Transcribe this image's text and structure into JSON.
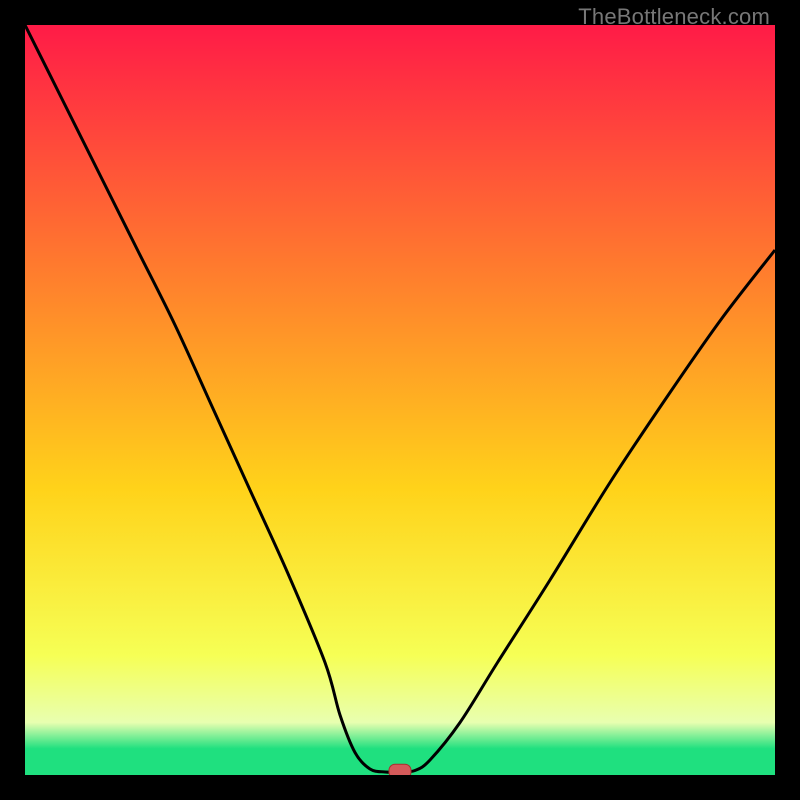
{
  "watermark": "TheBottleneck.com",
  "colors": {
    "top": "#ff1b47",
    "upper_mid": "#ff7a2e",
    "mid": "#ffd31a",
    "lower_mid": "#f6ff55",
    "pale": "#e8ffb0",
    "green": "#1fe07f",
    "curve": "#000000",
    "dot_fill": "#d45a5a",
    "dot_stroke": "#a82f2f",
    "frame": "#000000"
  },
  "chart_data": {
    "type": "line",
    "title": "",
    "xlabel": "",
    "ylabel": "",
    "xlim": [
      0,
      100
    ],
    "ylim": [
      0,
      100
    ],
    "curve": [
      {
        "x": 0,
        "y": 100
      },
      {
        "x": 5,
        "y": 90
      },
      {
        "x": 10,
        "y": 80
      },
      {
        "x": 15,
        "y": 70
      },
      {
        "x": 20,
        "y": 60
      },
      {
        "x": 25,
        "y": 49
      },
      {
        "x": 30,
        "y": 38
      },
      {
        "x": 35,
        "y": 27
      },
      {
        "x": 40,
        "y": 15
      },
      {
        "x": 42,
        "y": 8
      },
      {
        "x": 44,
        "y": 3
      },
      {
        "x": 46,
        "y": 0.8
      },
      {
        "x": 48,
        "y": 0.4
      },
      {
        "x": 50,
        "y": 0.4
      },
      {
        "x": 52,
        "y": 0.6
      },
      {
        "x": 54,
        "y": 2
      },
      {
        "x": 58,
        "y": 7
      },
      {
        "x": 63,
        "y": 15
      },
      {
        "x": 70,
        "y": 26
      },
      {
        "x": 78,
        "y": 39
      },
      {
        "x": 86,
        "y": 51
      },
      {
        "x": 93,
        "y": 61
      },
      {
        "x": 100,
        "y": 70
      }
    ],
    "optimum_marker": {
      "x": 50,
      "y": 0.5
    },
    "gradient_stops": [
      {
        "offset": 0.0,
        "key": "top"
      },
      {
        "offset": 0.32,
        "key": "upper_mid"
      },
      {
        "offset": 0.62,
        "key": "mid"
      },
      {
        "offset": 0.84,
        "key": "lower_mid"
      },
      {
        "offset": 0.93,
        "key": "pale"
      },
      {
        "offset": 0.965,
        "key": "green"
      },
      {
        "offset": 1.0,
        "key": "green"
      }
    ]
  }
}
